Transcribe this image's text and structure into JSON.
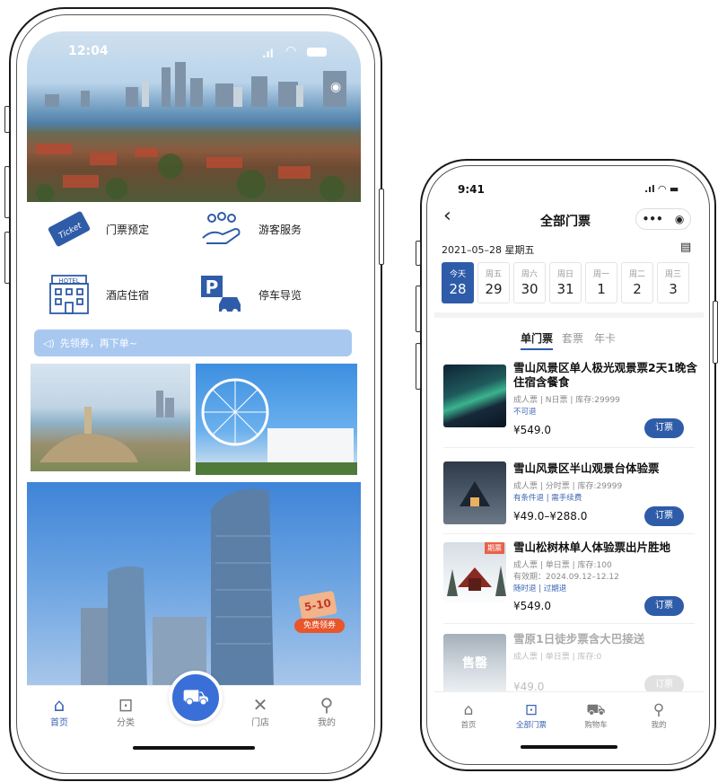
{
  "left_phone": {
    "status": {
      "time": "12:04"
    },
    "features": [
      {
        "label": "门票预定",
        "icon": "ticket-icon",
        "glyph": "Ticket"
      },
      {
        "label": "游客服务",
        "icon": "visitor-service-icon",
        "glyph": "⚇"
      },
      {
        "label": "酒店住宿",
        "icon": "hotel-icon",
        "glyph": "HOTEL"
      },
      {
        "label": "停车导览",
        "icon": "parking-icon",
        "glyph": "P"
      }
    ],
    "notice": {
      "icon": "speaker-icon",
      "text": "先领券，再下单~"
    },
    "promo_badge": {
      "number": "5-10",
      "text": "免费领券"
    },
    "bottom_nav": [
      {
        "label": "首页",
        "icon": "home-icon",
        "glyph": "⌂",
        "active": true
      },
      {
        "label": "分类",
        "icon": "bag-icon",
        "glyph": "⊡",
        "active": false
      },
      {
        "label": "门店",
        "icon": "store-icon",
        "glyph": "✕",
        "active": false
      },
      {
        "label": "我的",
        "icon": "user-icon",
        "glyph": "⚲",
        "active": false
      }
    ],
    "cart_icon": "cart-icon"
  },
  "right_phone": {
    "status": {
      "time": "9:41"
    },
    "header": {
      "title": "全部门票",
      "back_glyph": "‹",
      "more_glyph": "•••",
      "target_glyph": "◉"
    },
    "date_line": "2021–05–28 星期五",
    "dates": [
      {
        "weekday": "今天",
        "day": "28",
        "selected": true
      },
      {
        "weekday": "周五",
        "day": "29",
        "selected": false
      },
      {
        "weekday": "周六",
        "day": "30",
        "selected": false
      },
      {
        "weekday": "周日",
        "day": "31",
        "selected": false
      },
      {
        "weekday": "周一",
        "day": "1",
        "selected": false
      },
      {
        "weekday": "周二",
        "day": "2",
        "selected": false
      },
      {
        "weekday": "周三",
        "day": "3",
        "selected": false
      }
    ],
    "tabs": [
      {
        "label": "单门票",
        "active": true
      },
      {
        "label": "套票",
        "active": false
      },
      {
        "label": "年卡",
        "active": false
      }
    ],
    "tickets": [
      {
        "title": "雪山风景区单人极光观景票2天1晚含住宿含餐食",
        "meta": "成人票 | N日票 | 库存:29999",
        "validity": "",
        "tags": "不可退",
        "price": "¥549.0",
        "button": "订票",
        "badge": "",
        "overlay": "",
        "disabled": false
      },
      {
        "title": "雪山风景区半山观景台体验票",
        "meta": "成人票 | 分时票 | 库存:29999",
        "validity": "",
        "tags": "有条件退 | 需手续费",
        "price": "¥49.0–¥288.0",
        "button": "订票",
        "badge": "",
        "overlay": "",
        "disabled": false
      },
      {
        "title": "雪山松树林单人体验票出片胜地",
        "meta": "成人票 | 单日票 | 库存:100",
        "validity": "有效期：2024.09.12–12.12",
        "tags": "随时退 | 过期退",
        "price": "¥549.0",
        "button": "订票",
        "badge": "期票",
        "overlay": "",
        "disabled": false
      },
      {
        "title": "雪原1日徒步票含大巴接送",
        "meta": "成人票 | 单日票 | 库存:0",
        "validity": "",
        "tags": "",
        "price": "¥49.0",
        "button": "订票",
        "badge": "",
        "overlay": "售罄",
        "disabled": true
      }
    ],
    "bottom_nav": [
      {
        "label": "首页",
        "icon": "home-icon",
        "glyph": "⌂",
        "active": false
      },
      {
        "label": "全部门票",
        "icon": "ticket-bag-icon",
        "glyph": "⊡",
        "active": true
      },
      {
        "label": "购物车",
        "icon": "cart-icon",
        "glyph": "⛟",
        "active": false
      },
      {
        "label": "我的",
        "icon": "user-icon",
        "glyph": "⚲",
        "active": false
      }
    ]
  }
}
